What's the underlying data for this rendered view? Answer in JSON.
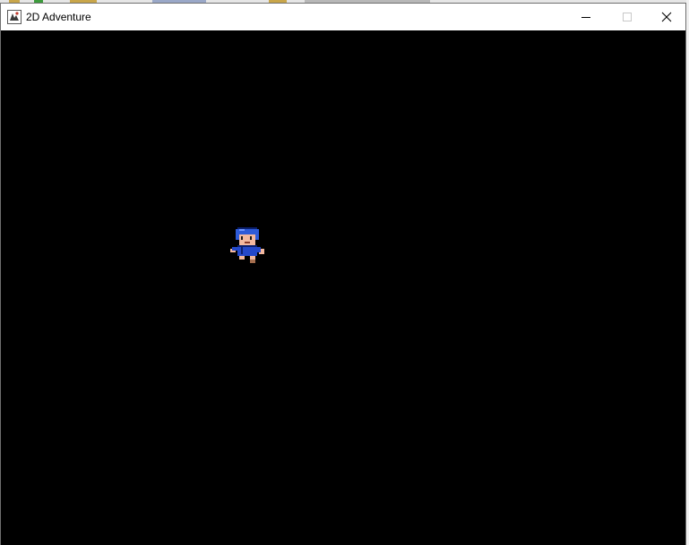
{
  "window": {
    "title": "2D Adventure",
    "icon": "java-app-icon",
    "controls": {
      "minimize_icon": "minimize-icon",
      "maximize_icon": "maximize-icon",
      "close_icon": "close-icon"
    }
  },
  "game": {
    "background_color": "#000000",
    "player_sprite": "player-sprite",
    "player_colors": {
      "hair": "#2e5bd8",
      "skin": "#f3b89e",
      "shirt": "#2448c8",
      "outline": "#0b1f6e",
      "shoes": "#a56e4e"
    }
  }
}
